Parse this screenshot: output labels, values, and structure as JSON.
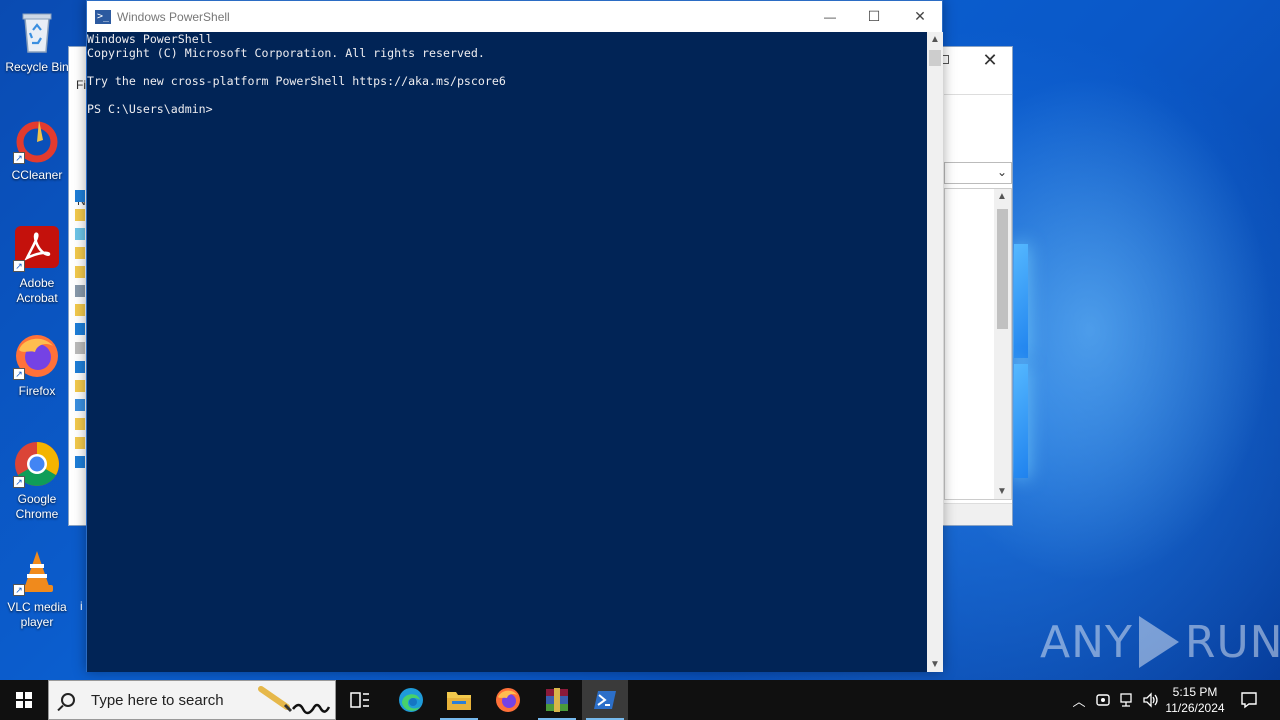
{
  "desktop": {
    "icons": [
      {
        "label": "Recycle Bin",
        "icon": "recycle-bin-icon"
      },
      {
        "label": "CCleaner",
        "icon": "ccleaner-icon"
      },
      {
        "label": "Adobe Acrobat",
        "icon": "adobe-acrobat-icon"
      },
      {
        "label": "Firefox",
        "icon": "firefox-icon"
      },
      {
        "label": "Google Chrome",
        "icon": "chrome-icon"
      },
      {
        "label": "VLC media player",
        "icon": "vlc-icon"
      }
    ]
  },
  "background_window": {
    "partial_letters": [
      "Fi",
      "N",
      "i"
    ]
  },
  "powershell": {
    "title": "Windows PowerShell",
    "console_lines": [
      "Windows PowerShell",
      "Copyright (C) Microsoft Corporation. All rights reserved.",
      "",
      "Try the new cross-platform PowerShell https://aka.ms/pscore6",
      "",
      "PS C:\\Users\\admin>"
    ],
    "controls": {
      "minimize": "—",
      "maximize": "☐",
      "close": "✕"
    },
    "colors": {
      "console_bg": "#012456",
      "console_fg": "#eeedf0"
    }
  },
  "watermark": {
    "left": "ANY",
    "right": "RUN"
  },
  "taskbar": {
    "search_placeholder": "Type here to search",
    "apps": [
      "task-view-icon",
      "edge-icon",
      "file-explorer-icon",
      "firefox-icon",
      "winrar-icon",
      "powershell-icon"
    ],
    "clock": {
      "time": "5:15 PM",
      "date": "11/26/2024"
    }
  }
}
